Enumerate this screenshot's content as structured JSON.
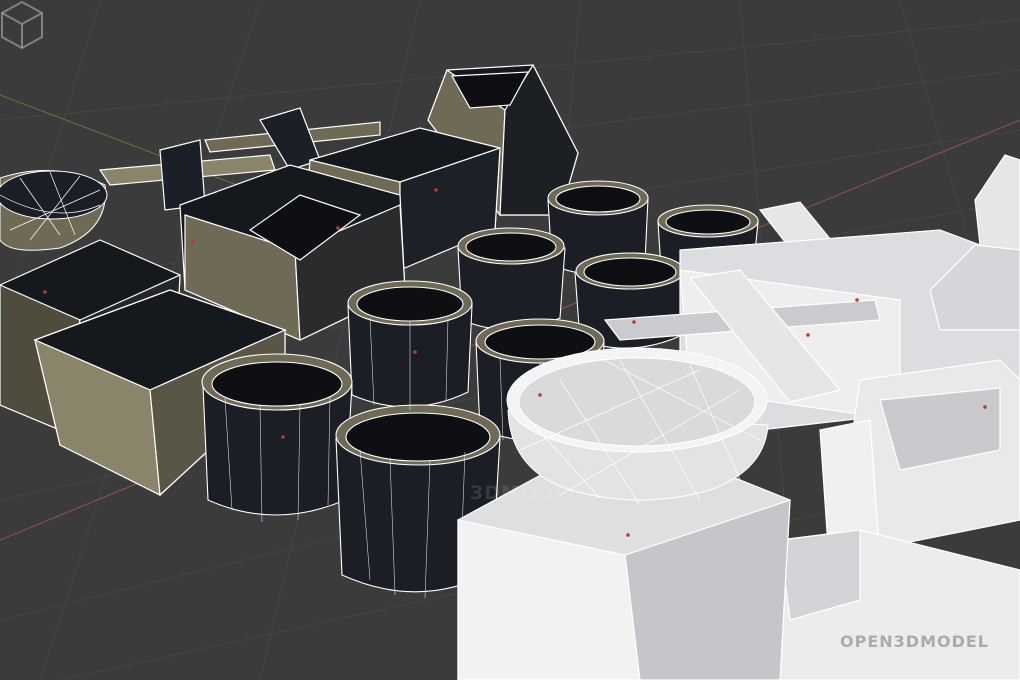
{
  "watermark": {
    "center_text": "3DMODEL",
    "corner_text": "OPEN3DMODEL"
  },
  "colors": {
    "background": "#3b3b3b",
    "grid_line": "#454545",
    "axis_x": "#8a4b4b",
    "axis_y": "#5d7a3d",
    "dark_face": "#15181d",
    "olive_face": "#6f6a55",
    "olive_light": "#8a846a",
    "white_face": "#e6e6e6",
    "white_shade": "#c9cbce",
    "wire": "#ffffff",
    "vertex": "#c0392b"
  }
}
